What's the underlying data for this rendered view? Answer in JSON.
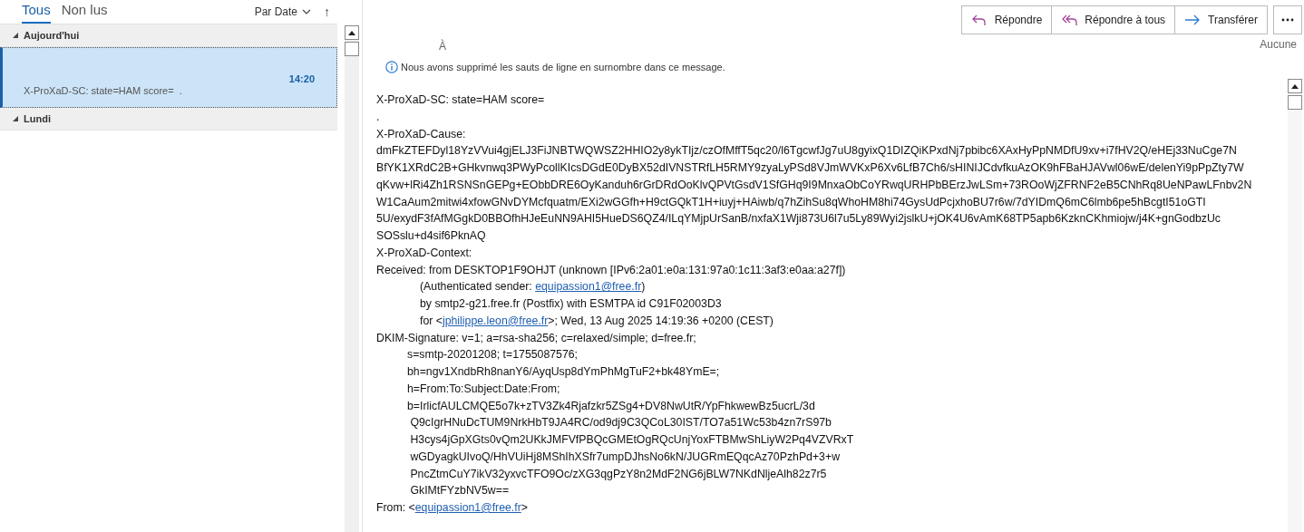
{
  "list_pane": {
    "filter_tabs": [
      {
        "label": "Tous",
        "selected": true
      },
      {
        "label": "Non lus",
        "selected": false
      }
    ],
    "sort": {
      "label": "Par Date",
      "direction": "↑"
    },
    "groups": [
      {
        "label": "Aujourd'hui",
        "expanded": true,
        "messages": [
          {
            "time": "14:20",
            "preview": "X-ProXaD-SC: state=HAM score=  .",
            "selected": true
          }
        ]
      },
      {
        "label": "Lundi",
        "expanded": true
      }
    ]
  },
  "reading_pane": {
    "actions": [
      {
        "label": "Répondre",
        "kind": "reply"
      },
      {
        "label": "Répondre à tous",
        "kind": "reply_all"
      },
      {
        "label": "Transférer",
        "kind": "forward"
      }
    ],
    "to_label": "À",
    "category": "Aucune",
    "info": "Nous avons supprimé les sauts de ligne en surnombre dans ce message.",
    "body": [
      {
        "kind": "header",
        "parts": [
          {
            "text": "X-ProXaD-SC: state=HAM score="
          }
        ]
      },
      {
        "kind": "header",
        "parts": [
          {
            "text": "."
          }
        ]
      },
      {
        "kind": "header",
        "parts": [
          {
            "text": "X-ProXaD-Cause:"
          }
        ]
      },
      {
        "kind": "header",
        "parts": [
          {
            "text": "dmFkZTEFDyl18YzVVui4gjELJ3FiJNBTWQWSZ2HHIO2y8ykTIjz/czOfMffT5qc20/l6TgcwfJg7uU8gyixQ1DIZQiKPxdNj7pbibc6XAxHyPpNMDfU9xv+i7fHV2Q/eHEj33NuCge7N"
          }
        ]
      },
      {
        "kind": "header",
        "parts": [
          {
            "text": "BfYK1XRdC2B+GHkvnwq3PWyPcollKIcsDGdE0DyBX52dIVNSTRfLH5RMY9zyaLyPSd8VJmWVKxP6Xv6LfB7Ch6/sHINIJCdvfkuAzOK9hFBaHJAVwl06wE/delenYi9pPpZty7W"
          }
        ]
      },
      {
        "kind": "header",
        "parts": [
          {
            "text": "qKvw+lRi4Zh1RSNSnGEPg+EObbDRE6OyKanduh6rGrDRdOoKlvQPVtGsdV1SfGHq9I9MnxaObCoYRwqURHPbBErzJwLSm+73ROoWjZFRNF2eB5CNhRq8UeNPawLFnbv2N"
          }
        ]
      },
      {
        "kind": "header",
        "parts": [
          {
            "text": "W1CaAum2mitwi4xfowGNvDYMcfquatm/EXi2wGGfh+H9ctGQkT1H+iuyj+HAiwb/q7hZihSu8qWhoHM8hi74GysUdPcjxhoBU7r6w/7dYIDmQ6mC6lmb6pe5hBcgtI51oGTI"
          }
        ]
      },
      {
        "kind": "header",
        "parts": [
          {
            "text": "5U/exydF3fAfMGgkD0BBOfhHJeEuNN9AHI5HueDS6QZ4/ILqYMjpUrSanB/nxfaX1Wji873U6l7u5Ly89Wyi2jslkU+jOK4U6vAmK68TP5apb6KzknCKhmiojw/j4K+gnGodbzUc"
          }
        ]
      },
      {
        "kind": "header",
        "parts": [
          {
            "text": "SOSslu+d4sif6PknAQ"
          }
        ]
      },
      {
        "kind": "header",
        "parts": [
          {
            "text": "X-ProXaD-Context:"
          }
        ]
      },
      {
        "kind": "header",
        "parts": [
          {
            "text": "Received: from DESKTOP1F9OHJT (unknown [IPv6:2a01:e0a:131:97a0:1c11:3af3:e0aa:a27f])"
          }
        ]
      },
      {
        "kind": "folded",
        "parts": [
          {
            "text": "(Authenticated sender: "
          },
          {
            "text": "equipassion1@free.fr",
            "kind": "link"
          },
          {
            "text": ")"
          }
        ]
      },
      {
        "kind": "folded",
        "parts": [
          {
            "text": "by smtp2-g21.free.fr (Postfix) with ESMTPA id C91F02003D3"
          }
        ]
      },
      {
        "kind": "folded",
        "parts": [
          {
            "text": "for <"
          },
          {
            "text": "jphilippe.leon@free.fr",
            "kind": "link"
          },
          {
            "text": ">; Wed, 13 Aug 2025 14:19:36 +0200 (CEST)"
          }
        ]
      },
      {
        "kind": "header",
        "parts": [
          {
            "text": "DKIM-Signature: v=1; a=rsa-sha256; c=relaxed/simple; d=free.fr;"
          }
        ]
      },
      {
        "kind": "folded_short",
        "parts": [
          {
            "text": "s=smtp-20201208; t=1755087576;"
          }
        ]
      },
      {
        "kind": "folded_short",
        "parts": [
          {
            "text": "bh=ngv1XndbRh8nanY6/AyqUsp8dYmPhMgTuF2+bk48YmE=;"
          }
        ]
      },
      {
        "kind": "folded_short",
        "parts": [
          {
            "text": "h=From:To:Subject:Date:From;"
          }
        ]
      },
      {
        "kind": "folded_short",
        "parts": [
          {
            "text": "b=IrlicfAULCMQE5o7k+zTV3Zk4Rjafzkr5ZSg4+DV8NwUtR/YpFhkwewBz5ucrL/3d"
          }
        ]
      },
      {
        "kind": "folded_short",
        "parts": [
          {
            "text": " Q9cIgrHNuDcTUM9NrkHbT9JA4RC/od9dj9C3QCoL30IST/TO7a51Wc53b4zn7rS97b"
          }
        ]
      },
      {
        "kind": "folded_short",
        "parts": [
          {
            "text": " H3cys4jGpXGts0vQm2UKkJMFVfPBQcGMEtOgRQcUnjYoxFTBMwShLiyW2Pq4VZVRxT"
          }
        ]
      },
      {
        "kind": "folded_short",
        "parts": [
          {
            "text": " wGDyagkUIvoQ/HhVUiHj8MShIhXSfr7umpDJhsNo6kN/JUGRmEQqcAz70PzhPd+3+w"
          }
        ]
      },
      {
        "kind": "folded_short",
        "parts": [
          {
            "text": " PncZtmCuY7ikV32yxvcTFO9Oc/zXG3qgPzY8n2MdF2NG6jBLW7NKdNljeAlh82z7r5"
          }
        ]
      },
      {
        "kind": "folded_short",
        "parts": [
          {
            "text": " GkIMtFYzbNV5w=="
          }
        ]
      },
      {
        "kind": "header",
        "parts": [
          {
            "text": "From: <"
          },
          {
            "text": "equipassion1@free.fr",
            "kind": "link"
          },
          {
            "text": ">"
          }
        ]
      }
    ]
  }
}
